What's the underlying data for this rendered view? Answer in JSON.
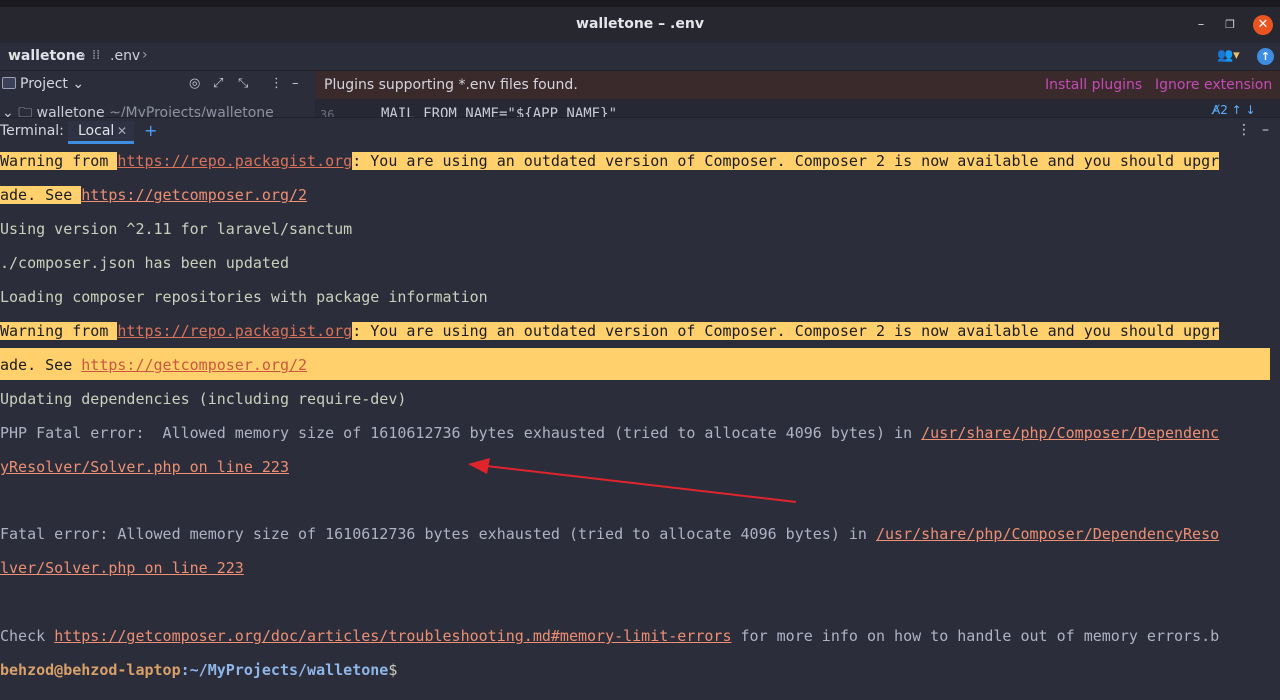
{
  "window": {
    "title": "walletone – .env"
  },
  "breadcrumb": {
    "project": "walletone",
    "file": ".env"
  },
  "project_panel": {
    "label": "Project",
    "tree_root": "walletone",
    "tree_path": "~/MyProjects/walletone"
  },
  "banner": {
    "text": "Plugins supporting *.env files found.",
    "install": "Install plugins",
    "ignore": "Ignore extension"
  },
  "editor": {
    "line_number": "36",
    "code": "MAIL_FROM_NAME=\"${APP_NAME}\"",
    "tools": "A̸2 ↑ ↓"
  },
  "terminal": {
    "title": "Terminal:",
    "tab": "Local",
    "lines": {
      "l1a": "Warning from ",
      "l1link": "https://repo.packagist.org",
      "l1b": ": You are using an outdated version of Composer. Composer 2 is now available and you should upgr",
      "l2a": "ade. See ",
      "l2link": "https://getcomposer.org/2",
      "l3": "Using version ^2.11 for laravel/sanctum",
      "l4": "./composer.json has been updated",
      "l5": "Loading composer repositories with package information",
      "l6a": "Warning from ",
      "l6link": "https://repo.packagist.org",
      "l6b": ": You are using an outdated version of Composer. Composer 2 is now available and you should upgr",
      "l7a": "ade. See ",
      "l7link": "https://getcomposer.org/2",
      "l8": "Updating dependencies (including require-dev)",
      "l9a": "PHP Fatal error:  Allowed memory size of 1610612736 bytes exhausted (tried to allocate 4096 bytes) in ",
      "l9link": "/usr/share/php/Composer/Dependenc",
      "l10link": "yResolver/Solver.php on line 223",
      "l11a": "Fatal error: Allowed memory size of 1610612736 bytes exhausted (tried to allocate 4096 bytes) in ",
      "l11link": "/usr/share/php/Composer/DependencyReso",
      "l12link": "lver/Solver.php on line 223",
      "l13a": "Check ",
      "l13link": "https://getcomposer.org/doc/articles/troubleshooting.md#memory-limit-errors",
      "l13b": " for more info on how to handle out of memory errors.b",
      "prompt_user": "behzod@behzod-laptop",
      "prompt_path": ":~/MyProjects/walletone",
      "prompt_sign": "$"
    }
  },
  "colors": {
    "highlight": "#ffd06b",
    "link": "#ec8f73",
    "arrow": "#e0242b",
    "accent": "#3d8ee0"
  }
}
